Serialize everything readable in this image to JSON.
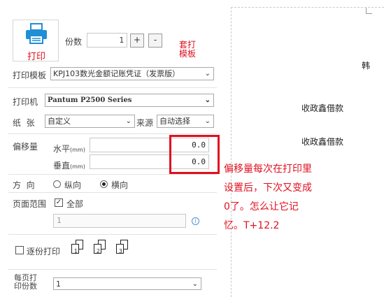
{
  "print_button": {
    "label": "打印"
  },
  "copies": {
    "label": "份数",
    "value": "1",
    "plus": "+",
    "minus": "-"
  },
  "overlay_print": {
    "label_line1": "套打",
    "label_line2": "模板"
  },
  "template": {
    "label": "打印模板",
    "value": "KPJ103数光金额记账凭证（发票版）"
  },
  "printer": {
    "label": "打印机",
    "value": "Pantum P2500 Series"
  },
  "paper": {
    "label": "纸  张",
    "value": "自定义",
    "source_label": "来源",
    "source_value": "自动选择"
  },
  "offset": {
    "label": "偏移量",
    "horizontal_label": "水平",
    "horizontal_unit": "(mm)",
    "horizontal_value": "0.0",
    "vertical_label": "垂直",
    "vertical_unit": "(mm)",
    "vertical_value": "0.0"
  },
  "orientation": {
    "label": "方  向",
    "portrait": "纵向",
    "landscape": "横向",
    "selected": "landscape"
  },
  "page_range": {
    "label": "页面范围",
    "all_label": "全部",
    "range_value": "1",
    "info_icon": "i"
  },
  "collate": {
    "label": "逐份打印",
    "pages": [
      "1",
      "2",
      "3"
    ]
  },
  "per_page_copies": {
    "label_line1": "每页打",
    "label_line2": "印份数",
    "value": "1"
  },
  "annotation": {
    "lines": [
      "偏移量每次在打印里",
      "设置后，下次又变成",
      "0了。怎么让它记",
      "忆。T+12.2"
    ]
  },
  "preview": {
    "top_right_char": "韩",
    "line1": "收政鑫借款",
    "line2": "收政鑫借款"
  },
  "colors": {
    "accent_red": "#e0101f",
    "printer_icon": "#1f8fd6"
  }
}
